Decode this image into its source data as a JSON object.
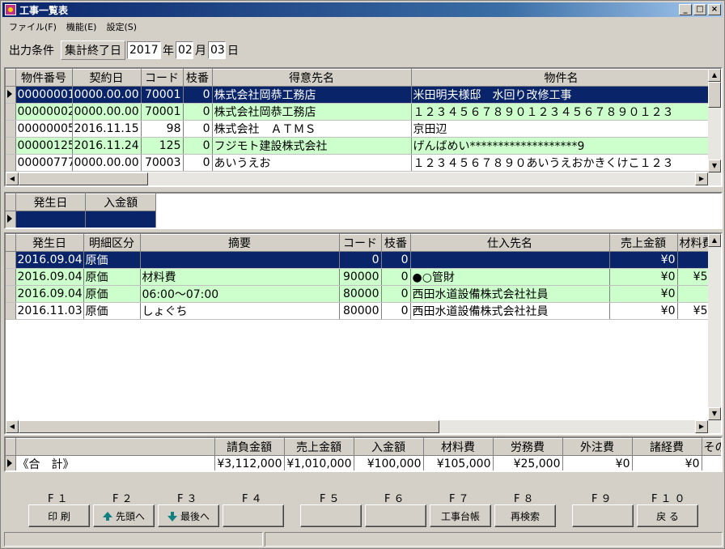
{
  "window": {
    "title": "工事一覧表",
    "min": "_",
    "max": "□",
    "close": "×"
  },
  "menu": [
    "ファイル(F)",
    "機能(E)",
    "設定(S)"
  ],
  "condition": {
    "label": "出力条件",
    "type": "集計終了日",
    "year": "2017",
    "year_unit": "年",
    "month": "02",
    "month_unit": "月",
    "day": "03",
    "day_unit": "日"
  },
  "projects": {
    "columns": [
      "物件番号",
      "契約日",
      "コード",
      "枝番",
      "得意先名",
      "物件名"
    ],
    "rows": [
      [
        "00000001",
        "0000.00.00",
        "70001",
        "0",
        "株式会社岡恭工務店",
        "米田明夫様邸　水回り改修工事"
      ],
      [
        "00000002",
        "0000.00.00",
        "70001",
        "0",
        "株式会社岡恭工務店",
        "１２３４５６７８９０１２３４５６７８９０１２３"
      ],
      [
        "00000005",
        "2016.11.15",
        "98",
        "0",
        "株式会社　ＡＴＭＳ",
        "京田辺"
      ],
      [
        "00000125",
        "2016.11.24",
        "125",
        "0",
        "フジモト建設株式会社",
        "げんばめい*******************9"
      ],
      [
        "00000777",
        "0000.00.00",
        "70003",
        "0",
        "あいうえお",
        "１２３４５６７８９０あいうえおかきくけこ１２３"
      ]
    ]
  },
  "payments": {
    "columns": [
      "発生日",
      "入金額"
    ]
  },
  "details": {
    "columns": [
      "発生日",
      "明細区分",
      "摘要",
      "コード",
      "枝番",
      "仕入先名",
      "売上金額",
      "材料費"
    ],
    "rows": [
      [
        "2016.09.04",
        "原価",
        "",
        "0",
        "0",
        "",
        "¥0",
        ""
      ],
      [
        "2016.09.04",
        "原価",
        "材料費",
        "90000",
        "0",
        "●○管財",
        "¥0",
        "¥5"
      ],
      [
        "2016.09.04",
        "原価",
        "06:00～07:00",
        "80000",
        "0",
        "西田水道設備株式会社社員",
        "¥0",
        ""
      ],
      [
        "2016.11.03",
        "原価",
        "しょぐち",
        "80000",
        "0",
        "西田水道設備株式会社社員",
        "¥0",
        "¥5"
      ]
    ]
  },
  "totals": {
    "columns": [
      "請負金額",
      "売上金額",
      "入金額",
      "材料費",
      "労務費",
      "外注費",
      "諸経費",
      "その他"
    ],
    "label": "《合　計》",
    "values": [
      "¥3,112,000",
      "¥1,010,000",
      "¥100,000",
      "¥105,000",
      "¥25,000",
      "¥0",
      "¥0",
      ""
    ]
  },
  "fkeys": {
    "labels": [
      "F１",
      "F２",
      "F３",
      "F４",
      "F５",
      "F６",
      "F７",
      "F８",
      "F９",
      "F１０"
    ],
    "buttons": [
      "印 刷",
      "先頭へ",
      "最後へ",
      "",
      "",
      "",
      "工事台帳",
      "再検索",
      "",
      "戻 る"
    ]
  },
  "colors": {
    "selected": "#0a246a",
    "alt_row": "#ccffcc",
    "face": "#d4d0c8"
  }
}
